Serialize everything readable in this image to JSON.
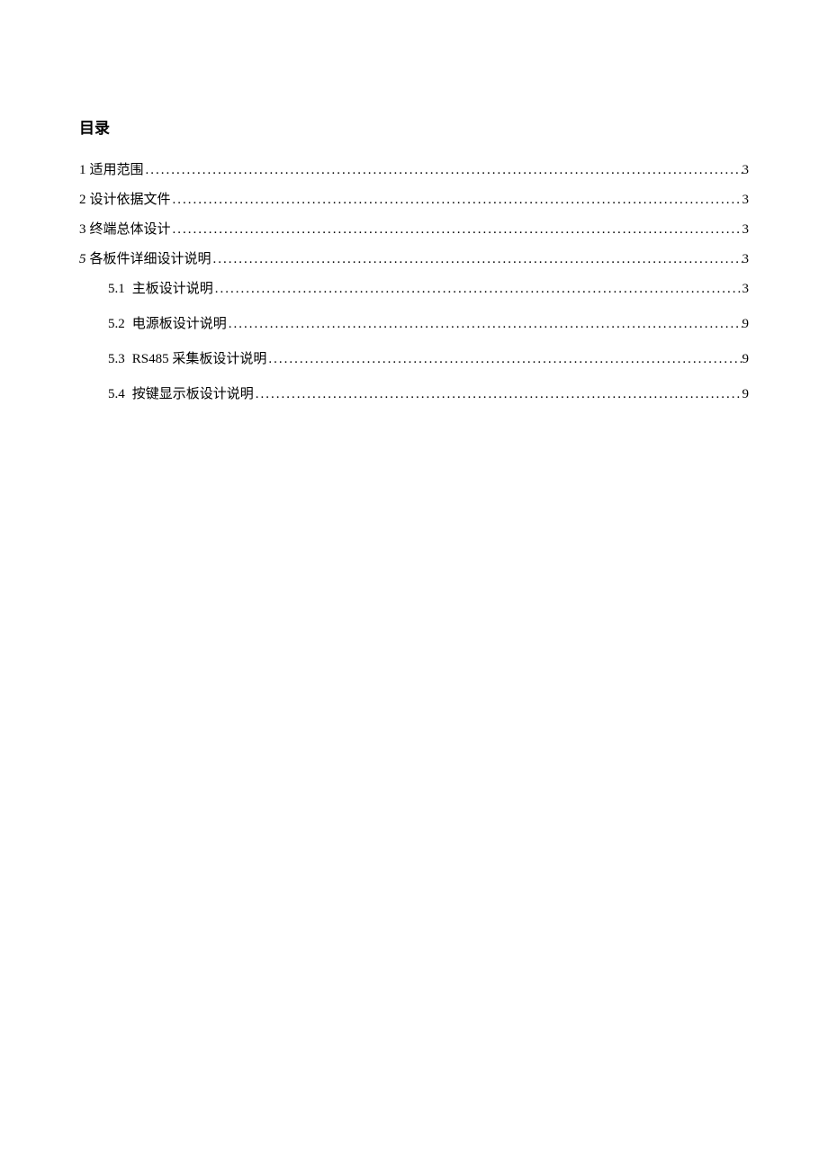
{
  "heading": "目录",
  "toc": [
    {
      "num": "1",
      "title": "适用范围",
      "page": "3",
      "level": 1,
      "italicNum": false
    },
    {
      "num": "2",
      "title": "设计依据文件",
      "page": "3",
      "level": 1,
      "italicNum": false
    },
    {
      "num": "3",
      "title": "终端总体设计",
      "page": "3",
      "level": 1,
      "italicNum": false
    },
    {
      "num": "5",
      "title": "各板件详细设计说明",
      "page": "3",
      "level": 1,
      "italicNum": true
    },
    {
      "num": "5.1",
      "title": "主板设计说明",
      "page": "3",
      "level": 2,
      "italicNum": false
    },
    {
      "num": "5.2",
      "title": "电源板设计说明",
      "page": "9",
      "level": 2,
      "italicNum": false
    },
    {
      "num": "5.3",
      "title": "RS485 采集板设计说明",
      "page": "9",
      "level": 2,
      "italicNum": false
    },
    {
      "num": "5.4",
      "title": "按键显示板设计说明",
      "page": "9",
      "level": 2,
      "italicNum": false
    }
  ]
}
